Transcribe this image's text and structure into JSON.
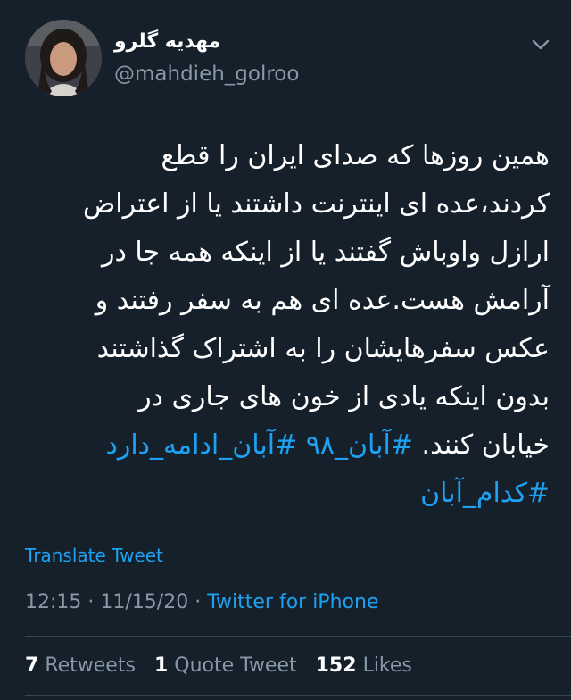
{
  "author": {
    "display_name": "مهدیه گلرو",
    "username": "@mahdieh_golroo"
  },
  "tweet": {
    "lines": [
      "همین روزها که صدای ایران را قطع",
      "کردند،عده ای اینترنت داشتند یا از اعتراض",
      "ارازل واوباش گفتند یا از اینکه همه جا در",
      "آرامش هست.عده ای هم به سفر رفتند و",
      "عکس سفرهایشان را به اشتراک گذاشتند",
      "بدون اینکه یادی از خون های جاری در"
    ],
    "last_line_text": "خیابان کنند.",
    "hashtags": [
      "#آبان_۹۸",
      "#آبان_ادامه_دارد",
      "#کدام_آبان"
    ]
  },
  "translate_label": "Translate Tweet",
  "meta": {
    "time": "12:15",
    "date": "11/15/20",
    "separator": "·",
    "source": "Twitter for iPhone"
  },
  "stats": {
    "retweets_count": "7",
    "retweets_label": "Retweets",
    "quotes_count": "1",
    "quotes_label": "Quote Tweet",
    "likes_count": "152",
    "likes_label": "Likes"
  },
  "colors": {
    "background": "#15202b",
    "accent": "#1da1f2",
    "secondary_text": "#8899a6",
    "divider": "#38444d"
  }
}
